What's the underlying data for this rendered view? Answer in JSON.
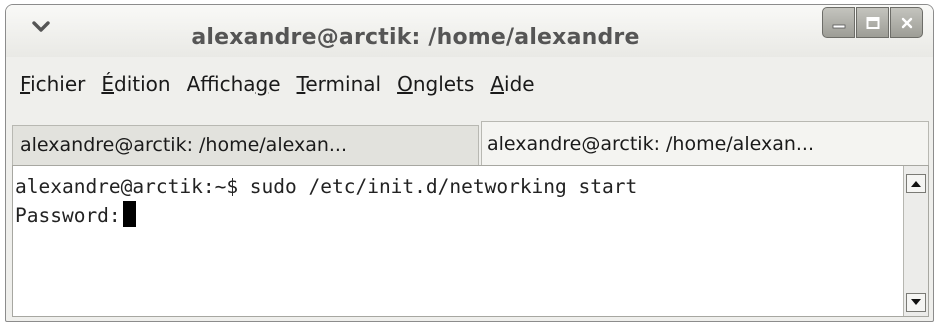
{
  "window": {
    "title": "alexandre@arctik: /home/alexandre"
  },
  "menubar": {
    "items": [
      {
        "mnemonic": "F",
        "rest": "ichier"
      },
      {
        "mnemonic": "É",
        "rest": "dition"
      },
      {
        "pre": "Afficha",
        "mnemonic": "g",
        "rest": "e"
      },
      {
        "mnemonic": "T",
        "rest": "erminal"
      },
      {
        "mnemonic": "O",
        "rest": "nglets"
      },
      {
        "mnemonic": "A",
        "rest": "ide"
      }
    ]
  },
  "tabs": [
    {
      "label": "alexandre@arctik: /home/alexan...",
      "active": false
    },
    {
      "label": "alexandre@arctik: /home/alexan...",
      "active": true
    }
  ],
  "terminal": {
    "line1": "alexandre@arctik:~$ sudo /etc/init.d/networking start",
    "line2": "Password:"
  },
  "icons": {
    "menu": "chevron-down-icon",
    "minimize": "minimize-icon",
    "maximize": "maximize-icon",
    "close": "close-icon",
    "scroll_up": "arrow-up-icon",
    "scroll_down": "arrow-down-icon"
  }
}
